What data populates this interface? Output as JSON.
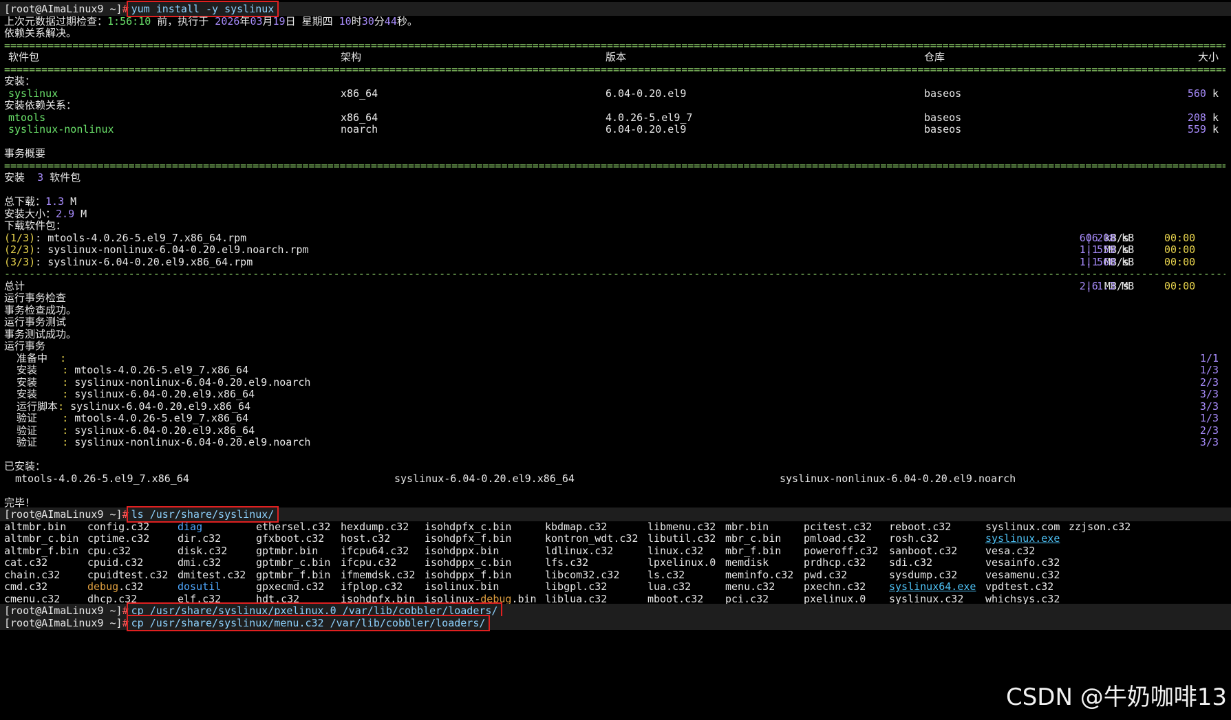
{
  "prompt": "[root@AImaLinux9 ~]",
  "hash": "#",
  "cmd1": "yum install -y syslinux",
  "meta_line": {
    "a": "上次元数据过期检查：",
    "t1": "1:56:10",
    "b": " 前，执行于 ",
    "y": "2026",
    "c": "年",
    "m": "03",
    "d": "月",
    "day": "19",
    "e": "日 星期四 ",
    "h": "10",
    "f": "时",
    "mi": "30",
    "g": "分",
    "s": "44",
    "z": "秒。"
  },
  "resolved": "依赖关系解决。",
  "sep_eq": "==================================================================================================================================================================================================================================",
  "sep_dash": "--------------------------------------------------------------------------------------------------------------------------------------------------------------------------------------------------------------------------------------",
  "headers": {
    "pkg": "软件包",
    "arch": "架构",
    "ver": "版本",
    "repo": "仓库",
    "size": "大小"
  },
  "install_label": "安装：",
  "dep_label": "安装依赖关系：",
  "packages": [
    {
      "name": "syslinux",
      "arch": "x86_64",
      "ver": "6.04-0.20.el9",
      "repo": "baseos",
      "size": "560",
      "unit": " k"
    },
    {
      "name": "mtools",
      "arch": "x86_64",
      "ver": "4.0.26-5.el9_7",
      "repo": "baseos",
      "size": "208",
      "unit": " k"
    },
    {
      "name": "syslinux-nonlinux",
      "arch": "noarch",
      "ver": "6.04-0.20.el9",
      "repo": "baseos",
      "size": "559",
      "unit": " k"
    }
  ],
  "summary_title": "事务概要",
  "install_count": {
    "a": "安装  ",
    "n": "3",
    "b": " 软件包"
  },
  "total_download": {
    "label": "总下载：",
    "n": "1.3",
    "u": " M"
  },
  "install_size": {
    "label": "安装大小：",
    "n": "2.9",
    "u": " M"
  },
  "download_label": "下载软件包：",
  "downloads": [
    {
      "idx": "(1/3)",
      "file": ": mtools-4.0.26-5.el9_7.x86_64.rpm",
      "rate": "606",
      "ru": " kB/s",
      "size": "208",
      "su": " kB",
      "time": "00:00"
    },
    {
      "idx": "(2/3)",
      "file": ": syslinux-nonlinux-6.04-0.20.el9.noarch.rpm",
      "rate": "1.1",
      "ru": " MB/s",
      "size": "559",
      "su": " kB",
      "time": "00:00"
    },
    {
      "idx": "(3/3)",
      "file": ": syslinux-6.04-0.20.el9.x86_64.rpm",
      "rate": "1.1",
      "ru": " MB/s",
      "size": "560",
      "su": " kB",
      "time": "00:00"
    }
  ],
  "total": {
    "label": "总计",
    "rate": "2.6",
    "ru": " MB/s",
    "size": "1.3",
    "su": " MB",
    "time": "00:00"
  },
  "tx_lines": [
    "运行事务检查",
    "事务检查成功。",
    "运行事务测试",
    "事务测试成功。",
    "运行事务"
  ],
  "steps": [
    {
      "label": "  准备中  ",
      "colon": ":",
      "text": "",
      "count": "1/1"
    },
    {
      "label": "  安装    ",
      "colon": ":",
      "text": " mtools-4.0.26-5.el9_7.x86_64",
      "count": "1/3"
    },
    {
      "label": "  安装    ",
      "colon": ":",
      "text": " syslinux-nonlinux-6.04-0.20.el9.noarch",
      "count": "2/3"
    },
    {
      "label": "  安装    ",
      "colon": ":",
      "text": " syslinux-6.04-0.20.el9.x86_64",
      "count": "3/3"
    },
    {
      "label": "  运行脚本",
      "colon": ":",
      "text": " syslinux-6.04-0.20.el9.x86_64",
      "count": "3/3"
    },
    {
      "label": "  验证    ",
      "colon": ":",
      "text": " mtools-4.0.26-5.el9_7.x86_64",
      "count": "1/3"
    },
    {
      "label": "  验证    ",
      "colon": ":",
      "text": " syslinux-6.04-0.20.el9.x86_64",
      "count": "2/3"
    },
    {
      "label": "  验证    ",
      "colon": ":",
      "text": " syslinux-nonlinux-6.04-0.20.el9.noarch",
      "count": "3/3"
    }
  ],
  "installed_label": "已安装：",
  "installed": [
    "mtools-4.0.26-5.el9_7.x86_64",
    "syslinux-6.04-0.20.el9.x86_64",
    "syslinux-nonlinux-6.04-0.20.el9.noarch"
  ],
  "done": "完毕！",
  "cmd2": "ls /usr/share/syslinux/",
  "ls_cols": [
    [
      "altmbr.bin",
      "altmbr_c.bin",
      "altmbr_f.bin",
      "cat.c32",
      "chain.c32",
      "cmd.c32",
      "cmenu.c32"
    ],
    [
      "config.c32",
      "cptime.c32",
      "cpu.c32",
      "cpuid.c32",
      "cpuidtest.c32",
      "debug|.c32",
      "dhcp.c32"
    ],
    [
      "diag",
      "dir.c32",
      "disk.c32",
      "dmi.c32",
      "dmitest.c32",
      "dosutil",
      "elf.c32"
    ],
    [
      "ethersel.c32",
      "gfxboot.c32",
      "gptmbr.bin",
      "gptmbr_c.bin",
      "gptmbr_f.bin",
      "gpxecmd.c32",
      "hdt.c32"
    ],
    [
      "hexdump.c32",
      "host.c32",
      "ifcpu64.c32",
      "ifcpu.c32",
      "ifmemdsk.c32",
      "ifplop.c32",
      "isohdpfx.bin"
    ],
    [
      "isohdpfx_c.bin",
      "isohdpfx_f.bin",
      "isohdppx.bin",
      "isohdppx_c.bin",
      "isohdppx_f.bin",
      "isolinux.bin",
      "isolinux-|debug|.bin"
    ],
    [
      "kbdmap.c32",
      "kontron_wdt.c32",
      "ldlinux.c32",
      "lfs.c32",
      "libcom32.c32",
      "libgpl.c32",
      "liblua.c32"
    ],
    [
      "libmenu.c32",
      "libutil.c32",
      "linux.c32",
      "lpxelinux.0",
      "ls.c32",
      "lua.c32",
      "mboot.c32"
    ],
    [
      "mbr.bin",
      "mbr_c.bin",
      "mbr_f.bin",
      "memdisk",
      "meminfo.c32",
      "menu.c32",
      "pci.c32"
    ],
    [
      "pcitest.c32",
      "pmload.c32",
      "poweroff.c32",
      "prdhcp.c32",
      "pwd.c32",
      "pxechn.c32",
      "pxelinux.0"
    ],
    [
      "reboot.c32",
      "rosh.c32",
      "sanboot.c32",
      "sdi.c32",
      "sysdump.c32",
      "syslinux64.exe",
      "syslinux.c32"
    ],
    [
      "syslinux.com",
      "syslinux.exe",
      "vesa.c32",
      "vesainfo.c32",
      "vesamenu.c32",
      "vpdtest.c32",
      "whichsys.c32"
    ],
    [
      "zzjson.c32"
    ]
  ],
  "cmd3": "cp /usr/share/syslinux/pxelinux.0 /var/lib/cobbler/loaders/",
  "cmd4": "cp /usr/share/syslinux/menu.c32 /var/lib/cobbler/loaders/",
  "watermark": "CSDN @牛奶咖啡13"
}
